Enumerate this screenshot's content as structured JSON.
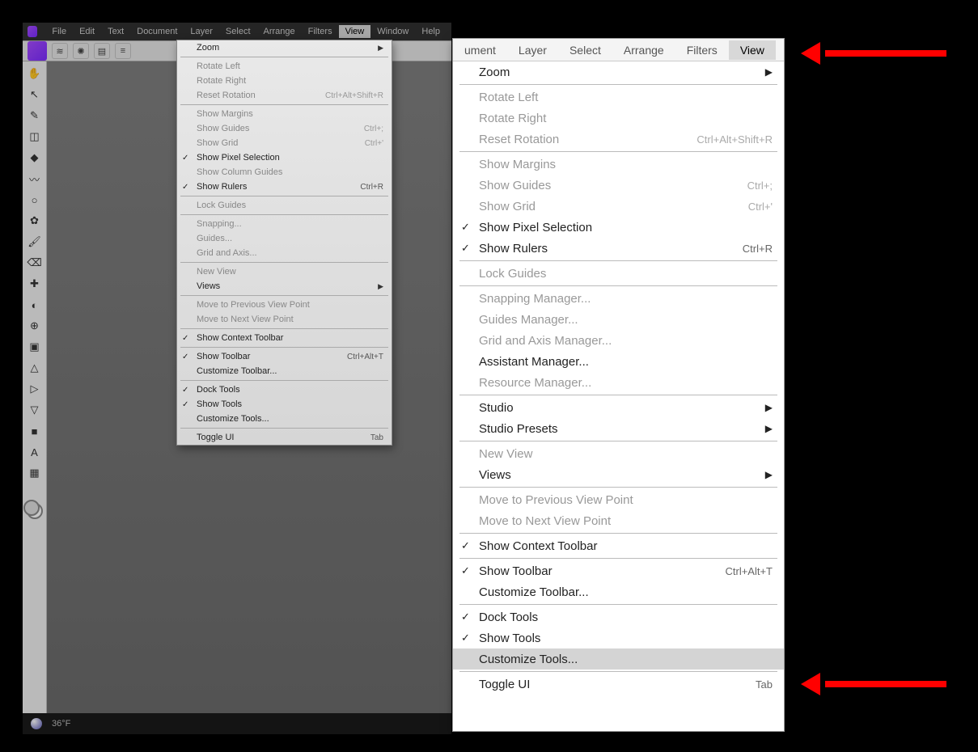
{
  "menubar": {
    "items": [
      "File",
      "Edit",
      "Text",
      "Document",
      "Layer",
      "Select",
      "Arrange",
      "Filters",
      "View",
      "Window",
      "Help"
    ],
    "active_index": 8
  },
  "taskbar": {
    "temperature": "36°F"
  },
  "view_menu_small": [
    {
      "type": "item",
      "label": "Zoom",
      "submenu": true
    },
    {
      "type": "sep"
    },
    {
      "type": "item",
      "label": "Rotate Left",
      "disabled": true
    },
    {
      "type": "item",
      "label": "Rotate Right",
      "disabled": true
    },
    {
      "type": "item",
      "label": "Reset Rotation",
      "shortcut": "Ctrl+Alt+Shift+R",
      "disabled": true
    },
    {
      "type": "sep"
    },
    {
      "type": "item",
      "label": "Show Margins",
      "disabled": true
    },
    {
      "type": "item",
      "label": "Show Guides",
      "shortcut": "Ctrl+;",
      "disabled": true
    },
    {
      "type": "item",
      "label": "Show Grid",
      "shortcut": "Ctrl+'",
      "disabled": true
    },
    {
      "type": "item",
      "label": "Show Pixel Selection",
      "checked": true
    },
    {
      "type": "item",
      "label": "Show Column Guides",
      "disabled": true
    },
    {
      "type": "item",
      "label": "Show Rulers",
      "shortcut": "Ctrl+R",
      "checked": true
    },
    {
      "type": "sep"
    },
    {
      "type": "item",
      "label": "Lock Guides",
      "disabled": true
    },
    {
      "type": "sep"
    },
    {
      "type": "item",
      "label": "Snapping...",
      "disabled": true
    },
    {
      "type": "item",
      "label": "Guides...",
      "disabled": true
    },
    {
      "type": "item",
      "label": "Grid and Axis...",
      "disabled": true
    },
    {
      "type": "sep"
    },
    {
      "type": "item",
      "label": "New View",
      "disabled": true
    },
    {
      "type": "item",
      "label": "Views",
      "submenu": true
    },
    {
      "type": "sep"
    },
    {
      "type": "item",
      "label": "Move to Previous View Point",
      "disabled": true
    },
    {
      "type": "item",
      "label": "Move to Next View Point",
      "disabled": true
    },
    {
      "type": "sep"
    },
    {
      "type": "item",
      "label": "Show Context Toolbar",
      "checked": true
    },
    {
      "type": "sep"
    },
    {
      "type": "item",
      "label": "Show Toolbar",
      "shortcut": "Ctrl+Alt+T",
      "checked": true
    },
    {
      "type": "item",
      "label": "Customize Toolbar..."
    },
    {
      "type": "sep"
    },
    {
      "type": "item",
      "label": "Dock Tools",
      "checked": true
    },
    {
      "type": "item",
      "label": "Show Tools",
      "checked": true
    },
    {
      "type": "item",
      "label": "Customize Tools..."
    },
    {
      "type": "sep"
    },
    {
      "type": "item",
      "label": "Toggle UI",
      "shortcut": "Tab"
    }
  ],
  "zoom_menubar": {
    "items": [
      "ument",
      "Layer",
      "Select",
      "Arrange",
      "Filters",
      "View"
    ],
    "active_index": 5
  },
  "view_menu_large": [
    {
      "type": "item",
      "label": "Zoom",
      "submenu": true
    },
    {
      "type": "sep"
    },
    {
      "type": "item",
      "label": "Rotate Left",
      "disabled": true
    },
    {
      "type": "item",
      "label": "Rotate Right",
      "disabled": true
    },
    {
      "type": "item",
      "label": "Reset Rotation",
      "shortcut": "Ctrl+Alt+Shift+R",
      "disabled": true
    },
    {
      "type": "sep"
    },
    {
      "type": "item",
      "label": "Show Margins",
      "disabled": true
    },
    {
      "type": "item",
      "label": "Show Guides",
      "shortcut": "Ctrl+;",
      "disabled": true
    },
    {
      "type": "item",
      "label": "Show Grid",
      "shortcut": "Ctrl+'",
      "disabled": true
    },
    {
      "type": "item",
      "label": "Show Pixel Selection",
      "checked": true
    },
    {
      "type": "item",
      "label": "Show Rulers",
      "shortcut": "Ctrl+R",
      "checked": true
    },
    {
      "type": "sep"
    },
    {
      "type": "item",
      "label": "Lock Guides",
      "disabled": true
    },
    {
      "type": "sep"
    },
    {
      "type": "item",
      "label": "Snapping Manager...",
      "disabled": true
    },
    {
      "type": "item",
      "label": "Guides Manager...",
      "disabled": true
    },
    {
      "type": "item",
      "label": "Grid and Axis Manager...",
      "disabled": true
    },
    {
      "type": "item",
      "label": "Assistant Manager..."
    },
    {
      "type": "item",
      "label": "Resource Manager...",
      "disabled": true
    },
    {
      "type": "sep"
    },
    {
      "type": "item",
      "label": "Studio",
      "submenu": true
    },
    {
      "type": "item",
      "label": "Studio Presets",
      "submenu": true
    },
    {
      "type": "sep"
    },
    {
      "type": "item",
      "label": "New View",
      "disabled": true
    },
    {
      "type": "item",
      "label": "Views",
      "submenu": true
    },
    {
      "type": "sep"
    },
    {
      "type": "item",
      "label": "Move to Previous View Point",
      "disabled": true
    },
    {
      "type": "item",
      "label": "Move to Next View Point",
      "disabled": true
    },
    {
      "type": "sep"
    },
    {
      "type": "item",
      "label": "Show Context Toolbar",
      "checked": true
    },
    {
      "type": "sep"
    },
    {
      "type": "item",
      "label": "Show Toolbar",
      "shortcut": "Ctrl+Alt+T",
      "checked": true
    },
    {
      "type": "item",
      "label": "Customize Toolbar..."
    },
    {
      "type": "sep"
    },
    {
      "type": "item",
      "label": "Dock Tools",
      "checked": true
    },
    {
      "type": "item",
      "label": "Show Tools",
      "checked": true
    },
    {
      "type": "item",
      "label": "Customize Tools...",
      "hover": true
    },
    {
      "type": "sep"
    },
    {
      "type": "item",
      "label": "Toggle UI",
      "shortcut": "Tab"
    }
  ],
  "tools": [
    "hand",
    "move",
    "pen",
    "crop",
    "node",
    "spray",
    "marquee",
    "clone",
    "brush",
    "eraser",
    "heal",
    "dodge",
    "stamp",
    "fill",
    "mesh",
    "shape",
    "vector",
    "rect",
    "text",
    "asset"
  ]
}
